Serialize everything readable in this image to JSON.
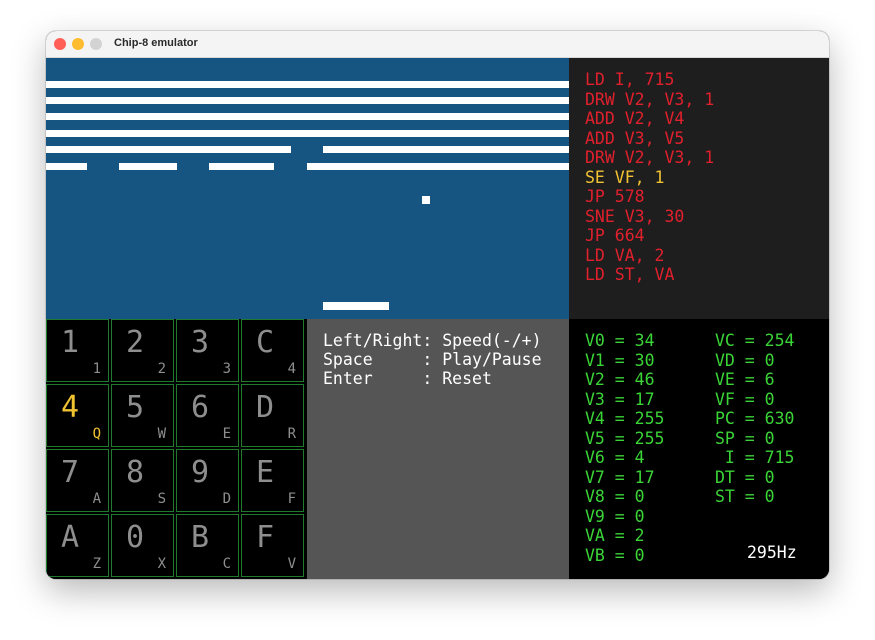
{
  "window": {
    "title": "Chip-8 emulator"
  },
  "disassembly": {
    "lines": [
      "LD I, 715",
      "DRW V2, V3, 1",
      "ADD V2, V4",
      "ADD V3, V5",
      "DRW V2, V3, 1",
      "SE VF, 1",
      "JP 578",
      "SNE V3, 30",
      "JP 664",
      "LD VA, 2",
      "LD ST, VA"
    ],
    "current_index": 5,
    "colors": {
      "normal": "#e0202c",
      "current": "#f1c232"
    }
  },
  "keypad": {
    "keys": [
      {
        "label": "1",
        "key": "1"
      },
      {
        "label": "2",
        "key": "2"
      },
      {
        "label": "3",
        "key": "3"
      },
      {
        "label": "C",
        "key": "4"
      },
      {
        "label": "4",
        "key": "Q"
      },
      {
        "label": "5",
        "key": "W"
      },
      {
        "label": "6",
        "key": "E"
      },
      {
        "label": "D",
        "key": "R"
      },
      {
        "label": "7",
        "key": "A"
      },
      {
        "label": "8",
        "key": "S"
      },
      {
        "label": "9",
        "key": "D"
      },
      {
        "label": "E",
        "key": "F"
      },
      {
        "label": "A",
        "key": "Z"
      },
      {
        "label": "0",
        "key": "X"
      },
      {
        "label": "B",
        "key": "C"
      },
      {
        "label": "F",
        "key": "V"
      }
    ],
    "active_label": "4",
    "colors": {
      "border": "#1f7a2e",
      "active": "#f1c232",
      "normal": "#8e8e8e"
    }
  },
  "help": {
    "lines": [
      "Left/Right: Speed(-/+)",
      "Space     : Play/Pause",
      "Enter     : Reset"
    ]
  },
  "registers": {
    "left": [
      "V0 = 34",
      "V1 = 30",
      "V2 = 46",
      "V3 = 17",
      "V4 = 255",
      "V5 = 255",
      "V6 = 4",
      "V7 = 17",
      "V8 = 0",
      "V9 = 0",
      "VA = 2",
      "VB = 0"
    ],
    "right": [
      "VC = 254",
      "VD = 0",
      "VE = 6",
      "VF = 0",
      "PC = 630",
      "SP = 0",
      " I = 715",
      "DT = 0",
      "ST = 0"
    ],
    "speed": "295Hz",
    "color": "#3bd437"
  },
  "screen": {
    "background": "#165482",
    "foreground": "#ffffff",
    "content": "Breakout-style game: brick rows, ball, paddle"
  }
}
